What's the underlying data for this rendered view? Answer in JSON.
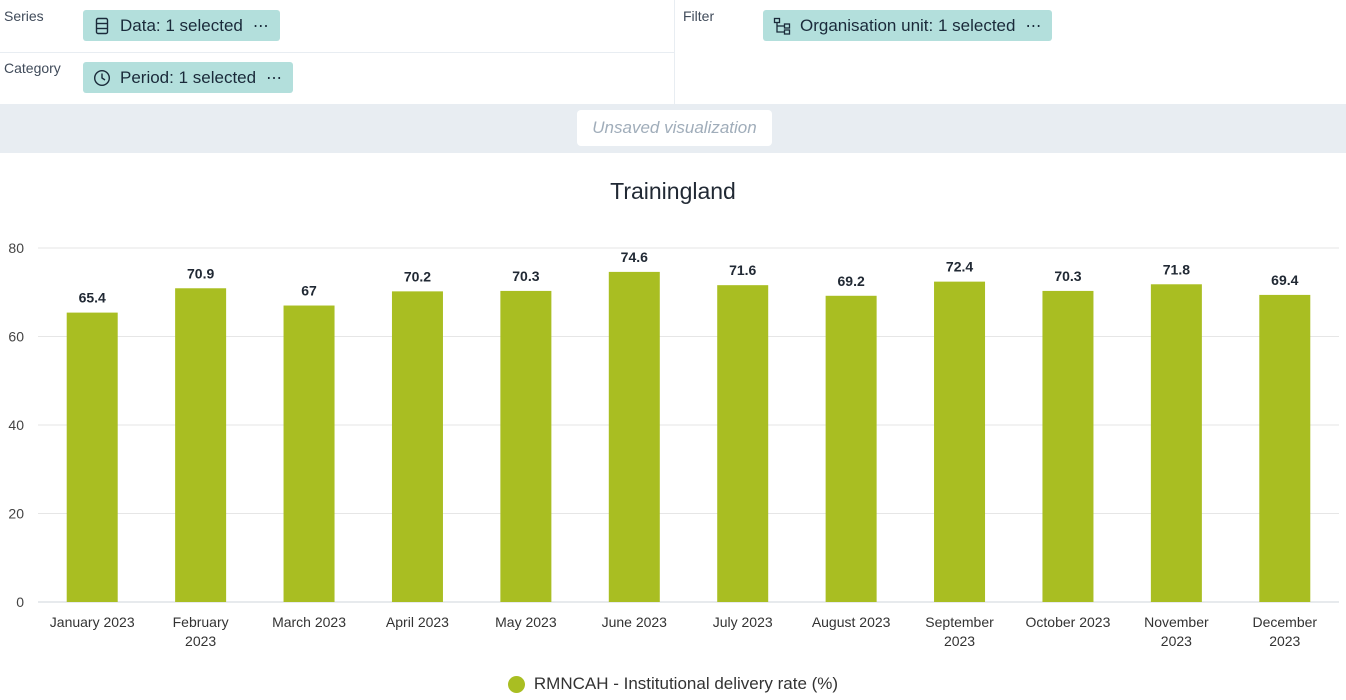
{
  "layout": {
    "series_label": "Series",
    "category_label": "Category",
    "filter_label": "Filter",
    "series_chip": "Data: 1 selected",
    "category_chip": "Period: 1 selected",
    "filter_chip": "Organisation unit: 1 selected",
    "chip_menu": "⋯"
  },
  "visualization": {
    "status": "Unsaved visualization"
  },
  "colors": {
    "chip_bg": "#b3dfdc",
    "bar": "#a9be22",
    "grid": "#e6e6e6",
    "titlebar_bg": "#e8edf2"
  },
  "chart_data": {
    "type": "bar",
    "title": "Trainingland",
    "categories": [
      [
        "January 2023"
      ],
      [
        "February",
        "2023"
      ],
      [
        "March 2023"
      ],
      [
        "April 2023"
      ],
      [
        "May 2023"
      ],
      [
        "June 2023"
      ],
      [
        "July 2023"
      ],
      [
        "August 2023"
      ],
      [
        "September",
        "2023"
      ],
      [
        "October 2023"
      ],
      [
        "November",
        "2023"
      ],
      [
        "December",
        "2023"
      ]
    ],
    "series": [
      {
        "name": "RMNCAH - Institutional delivery rate (%)",
        "values": [
          65.4,
          70.9,
          67,
          70.2,
          70.3,
          74.6,
          71.6,
          69.2,
          72.4,
          70.3,
          71.8,
          69.4
        ]
      }
    ],
    "ylim": [
      0,
      80
    ],
    "yticks": [
      0,
      20,
      40,
      60,
      80
    ],
    "grid": true,
    "data_labels": true,
    "legend_position": "bottom-center"
  }
}
